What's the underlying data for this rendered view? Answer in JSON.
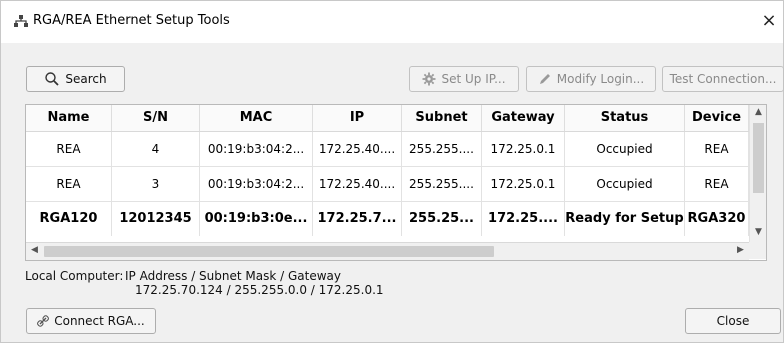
{
  "window": {
    "title": "RGA/REA Ethernet Setup Tools",
    "close_glyph": "×"
  },
  "toolbar": {
    "search_label": "Search",
    "setup_ip_label": "Set Up IP...",
    "modify_login_label": "Modify Login...",
    "test_connection_label": "Test Connection..."
  },
  "table": {
    "headers": [
      "Name",
      "S/N",
      "MAC",
      "IP",
      "Subnet",
      "Gateway",
      "Status",
      "Device"
    ],
    "rows": [
      [
        "REA",
        "4",
        "00:19:b3:04:2...",
        "172.25.40....",
        "255.255....",
        "172.25.0.1",
        "Occupied",
        "REA"
      ],
      [
        "REA",
        "3",
        "00:19:b3:04:2...",
        "172.25.40....",
        "255.255....",
        "172.25.0.1",
        "Occupied",
        "REA"
      ],
      [
        "RGA120",
        "12012345",
        "00:19:b3:0e...",
        "172.25.7...",
        "255.25...",
        "172.25....",
        "Ready for Setup",
        "RGA320"
      ]
    ]
  },
  "local_computer": {
    "label": "Local Computer:",
    "header": "IP Address / Subnet Mask / Gateway",
    "value": "172.25.70.124 / 255.255.0.0 / 172.25.0.1"
  },
  "footer": {
    "connect_label": "Connect RGA...",
    "close_label": "Close"
  },
  "icons": {
    "app": "network-icon",
    "search": "magnifier-icon",
    "setup": "gear-icon",
    "modify": "pencil-icon",
    "connect": "link-icon"
  }
}
